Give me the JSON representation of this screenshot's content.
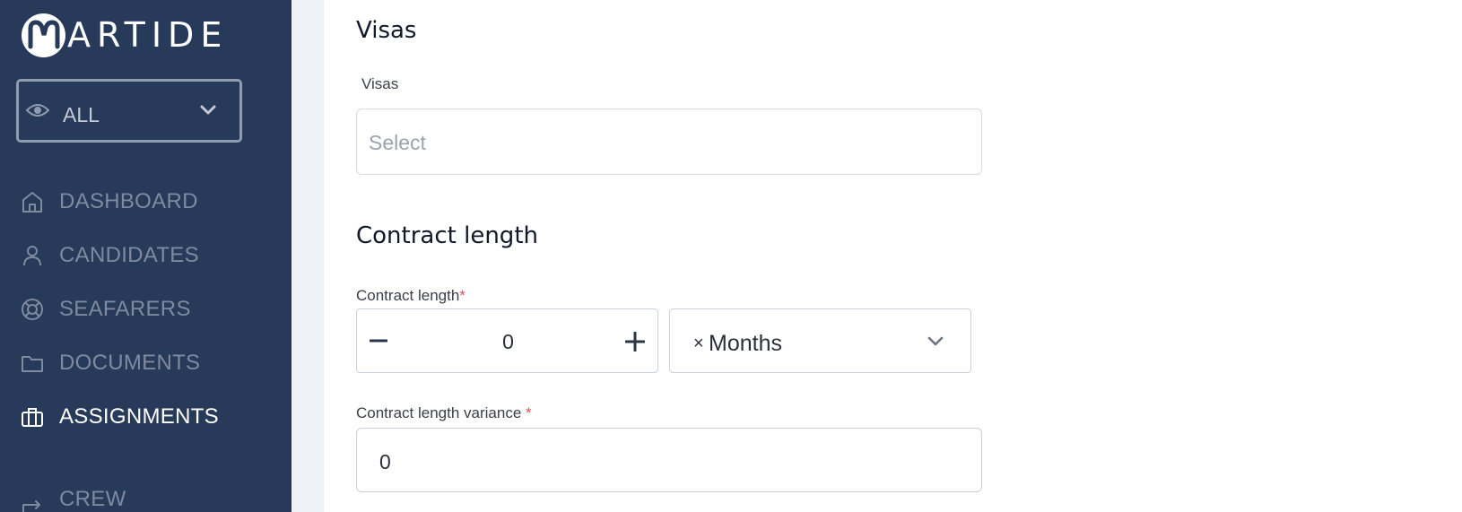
{
  "sidebar": {
    "logo_text": "ARTIDE",
    "view_select": {
      "value": "ALL"
    },
    "nav": [
      {
        "label": "DASHBOARD",
        "icon": "home-icon"
      },
      {
        "label": "CANDIDATES",
        "icon": "user-icon"
      },
      {
        "label": "SEAFARERS",
        "icon": "lifebuoy-icon"
      },
      {
        "label": "DOCUMENTS",
        "icon": "folder-icon"
      },
      {
        "label": "ASSIGNMENTS",
        "icon": "briefcase-icon",
        "active": true
      },
      {
        "label": "CREW CHANGE",
        "icon": "swap-icon"
      }
    ]
  },
  "visas_section": {
    "title": "Visas",
    "field_label": "Visas",
    "placeholder": "Select"
  },
  "contract_section": {
    "title": "Contract length",
    "length_label": "Contract length",
    "required_mark": "*",
    "length_value": "0",
    "unit_clear": "×",
    "unit_value": "Months",
    "variance_label": "Contract length variance",
    "variance_required_mark": "*",
    "variance_value": "0"
  },
  "colors": {
    "sidebar_bg": "#283a5a",
    "nav_inactive": "#7d8aa0",
    "nav_active": "#ffffff",
    "required": "#d9534f"
  }
}
